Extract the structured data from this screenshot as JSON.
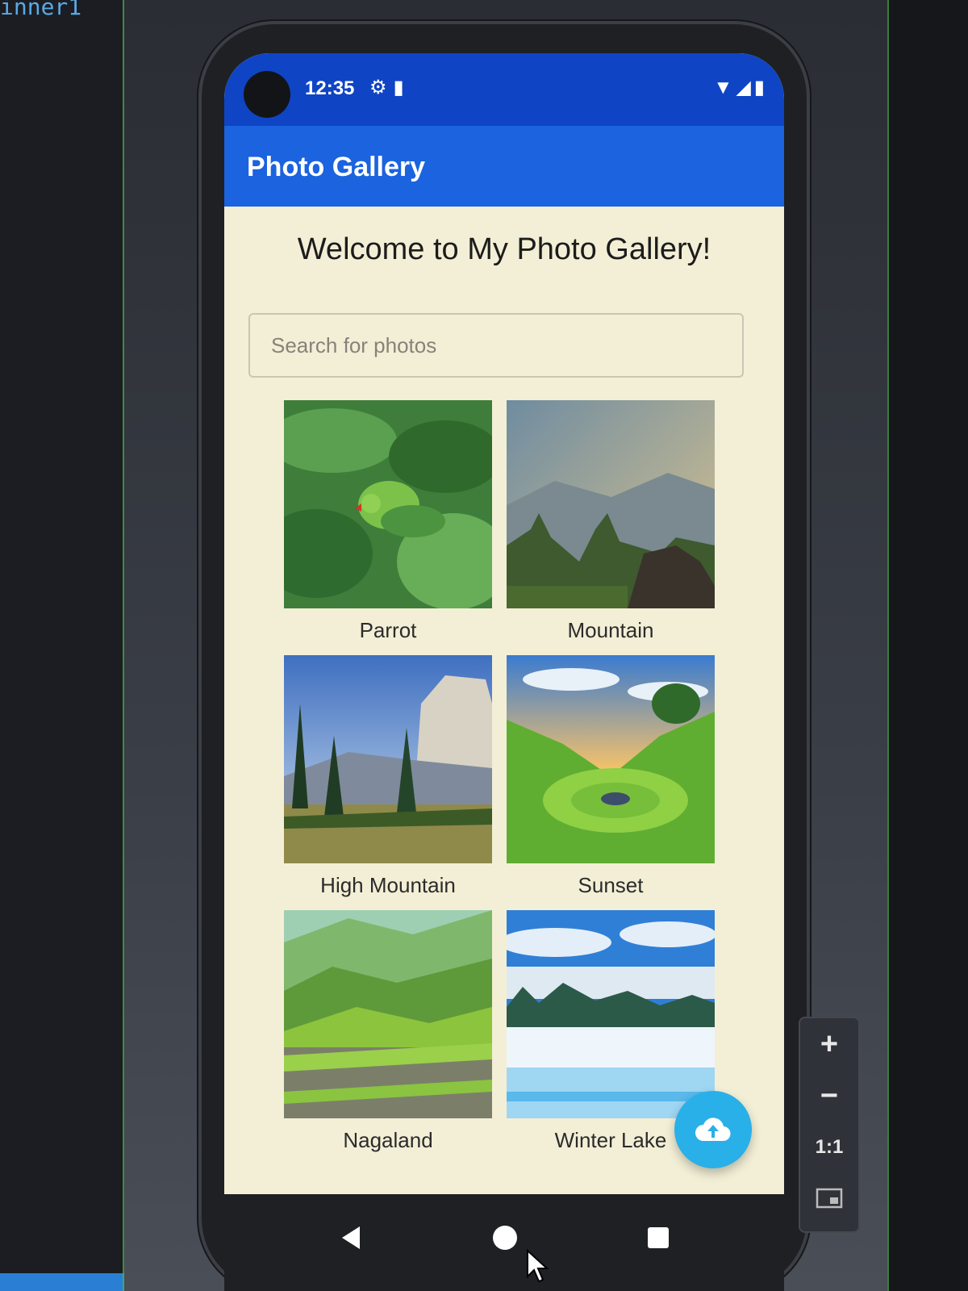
{
  "ide": {
    "code_fragment": "inner1"
  },
  "status_bar": {
    "time": "12:35",
    "icons_left": [
      "settings-icon",
      "sd-card-icon"
    ],
    "icons_right": [
      "wifi-icon",
      "signal-icon",
      "battery-icon"
    ]
  },
  "app_bar": {
    "title": "Photo Gallery"
  },
  "main": {
    "welcome": "Welcome to My Photo Gallery!",
    "search": {
      "placeholder": "Search for photos",
      "value": ""
    },
    "photos": [
      {
        "label": "Parrot",
        "icon": "parrot-photo"
      },
      {
        "label": "Mountain",
        "icon": "mountain-photo"
      },
      {
        "label": "High Mountain",
        "icon": "high-mountain-photo"
      },
      {
        "label": "Sunset",
        "icon": "sunset-photo"
      },
      {
        "label": "Nagaland",
        "icon": "nagaland-photo"
      },
      {
        "label": "Winter Lake",
        "icon": "winter-lake-photo"
      }
    ]
  },
  "fab": {
    "icon": "cloud-upload-icon"
  },
  "nav": {
    "buttons": [
      "back-icon",
      "home-icon",
      "recents-icon"
    ]
  },
  "zoom": {
    "zoom_in": "+",
    "zoom_out": "−",
    "actual_size": "1:1",
    "fit": "fit-screen-icon"
  },
  "colors": {
    "status_bar": "#0f45c4",
    "app_bar": "#1b63df",
    "background": "#f3efd6",
    "fab": "#2ab0e8"
  }
}
